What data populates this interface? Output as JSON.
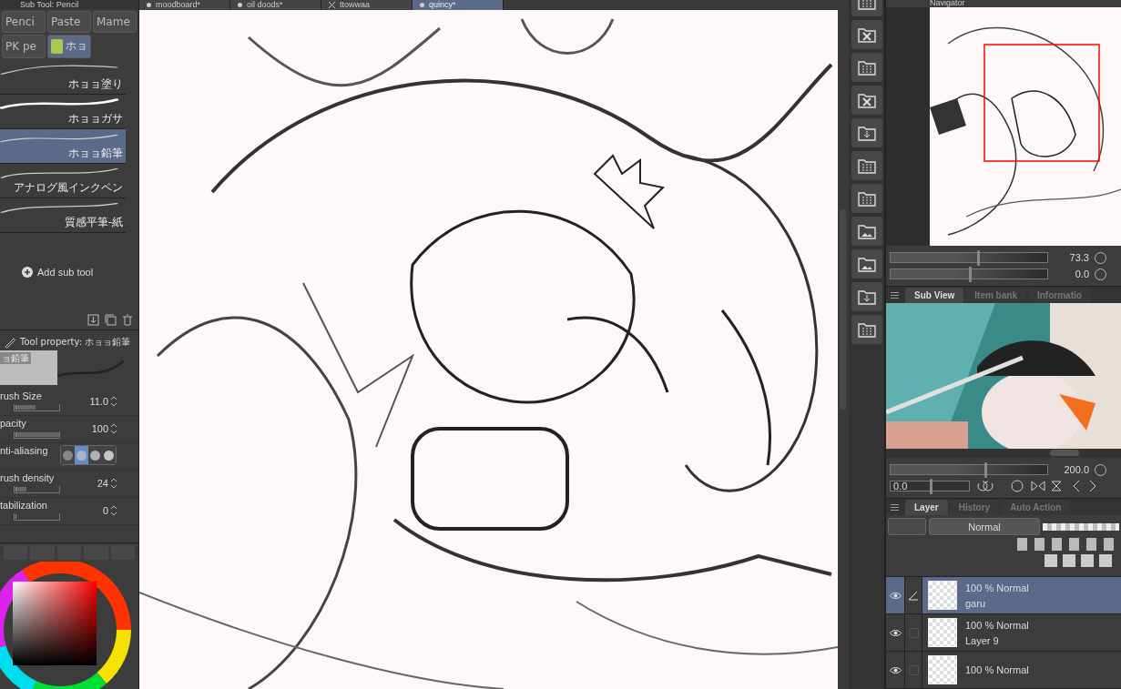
{
  "document_tabs": [
    {
      "label": "moodboard*",
      "selected": false,
      "kind": "modified"
    },
    {
      "label": "oil doods*",
      "selected": false,
      "kind": "modified"
    },
    {
      "label": "ttowwaa",
      "selected": false,
      "kind": "closable"
    },
    {
      "label": "quincy*",
      "selected": true,
      "kind": "modified"
    }
  ],
  "sub_tool": {
    "title": "Sub Tool: Pencil",
    "groups": [
      {
        "label": "Penci",
        "selected": false
      },
      {
        "label": "Paste",
        "selected": false
      },
      {
        "label": "Mame",
        "selected": false
      },
      {
        "label": "PK pe",
        "selected": false
      },
      {
        "label": "ホョ",
        "selected": true
      }
    ],
    "brushes": [
      {
        "label": "ホョョ塗り",
        "selected": false
      },
      {
        "label": "ホョョガサ",
        "selected": false
      },
      {
        "label": "ホョョ鉛筆",
        "selected": true
      },
      {
        "label": "アナログ風インクペン",
        "selected": false
      },
      {
        "label": "質感平筆-紙",
        "selected": false
      }
    ],
    "add_label": "Add sub tool"
  },
  "tool_property": {
    "title": "Tool property: ホョョ鉛筆",
    "preview_label": "ョ鉛筆",
    "properties": [
      {
        "label": "rush Size",
        "kind": "slider",
        "level": 0.45,
        "value": "11.0"
      },
      {
        "label": "pacity",
        "kind": "slider",
        "level": 1.0,
        "value": "100"
      },
      {
        "label": "nti-aliasing",
        "kind": "choice",
        "options": [
          {
            "selected": false
          },
          {
            "selected": true
          },
          {
            "selected": false
          },
          {
            "selected": false
          }
        ]
      },
      {
        "label": "rush density",
        "kind": "slider",
        "level": 0.24,
        "value": "24"
      },
      {
        "label": "tabilization",
        "kind": "slider",
        "level": 0.0,
        "value": "0"
      }
    ]
  },
  "navigator": {
    "title": "Navigator",
    "zoom": {
      "level": 0.55,
      "value": "73.3"
    },
    "rotation": {
      "level": 0.5,
      "value": "0.0"
    }
  },
  "sub_view": {
    "tabs": [
      {
        "label": "Sub View",
        "selected": true
      },
      {
        "label": "Item bank",
        "selected": false
      },
      {
        "label": "Informatio",
        "selected": false
      }
    ],
    "zoom": {
      "level": 0.6,
      "value": "200.0"
    },
    "rotation": {
      "level": 0.5,
      "value": "0.0"
    }
  },
  "layer_panel": {
    "tabs": [
      {
        "label": "Layer",
        "selected": true
      },
      {
        "label": "History",
        "selected": false
      },
      {
        "label": "Auto Action",
        "selected": false
      }
    ],
    "blend_mode": "Normal",
    "layers": [
      {
        "mode": "100 % Normal",
        "name": "garu",
        "selected": true,
        "editing": true,
        "visible": true
      },
      {
        "mode": "100 % Normal",
        "name": "Layer 9",
        "selected": false,
        "editing": false,
        "visible": true
      },
      {
        "mode": "100 % Normal",
        "selected": false,
        "editing": false,
        "visible": true
      }
    ]
  }
}
